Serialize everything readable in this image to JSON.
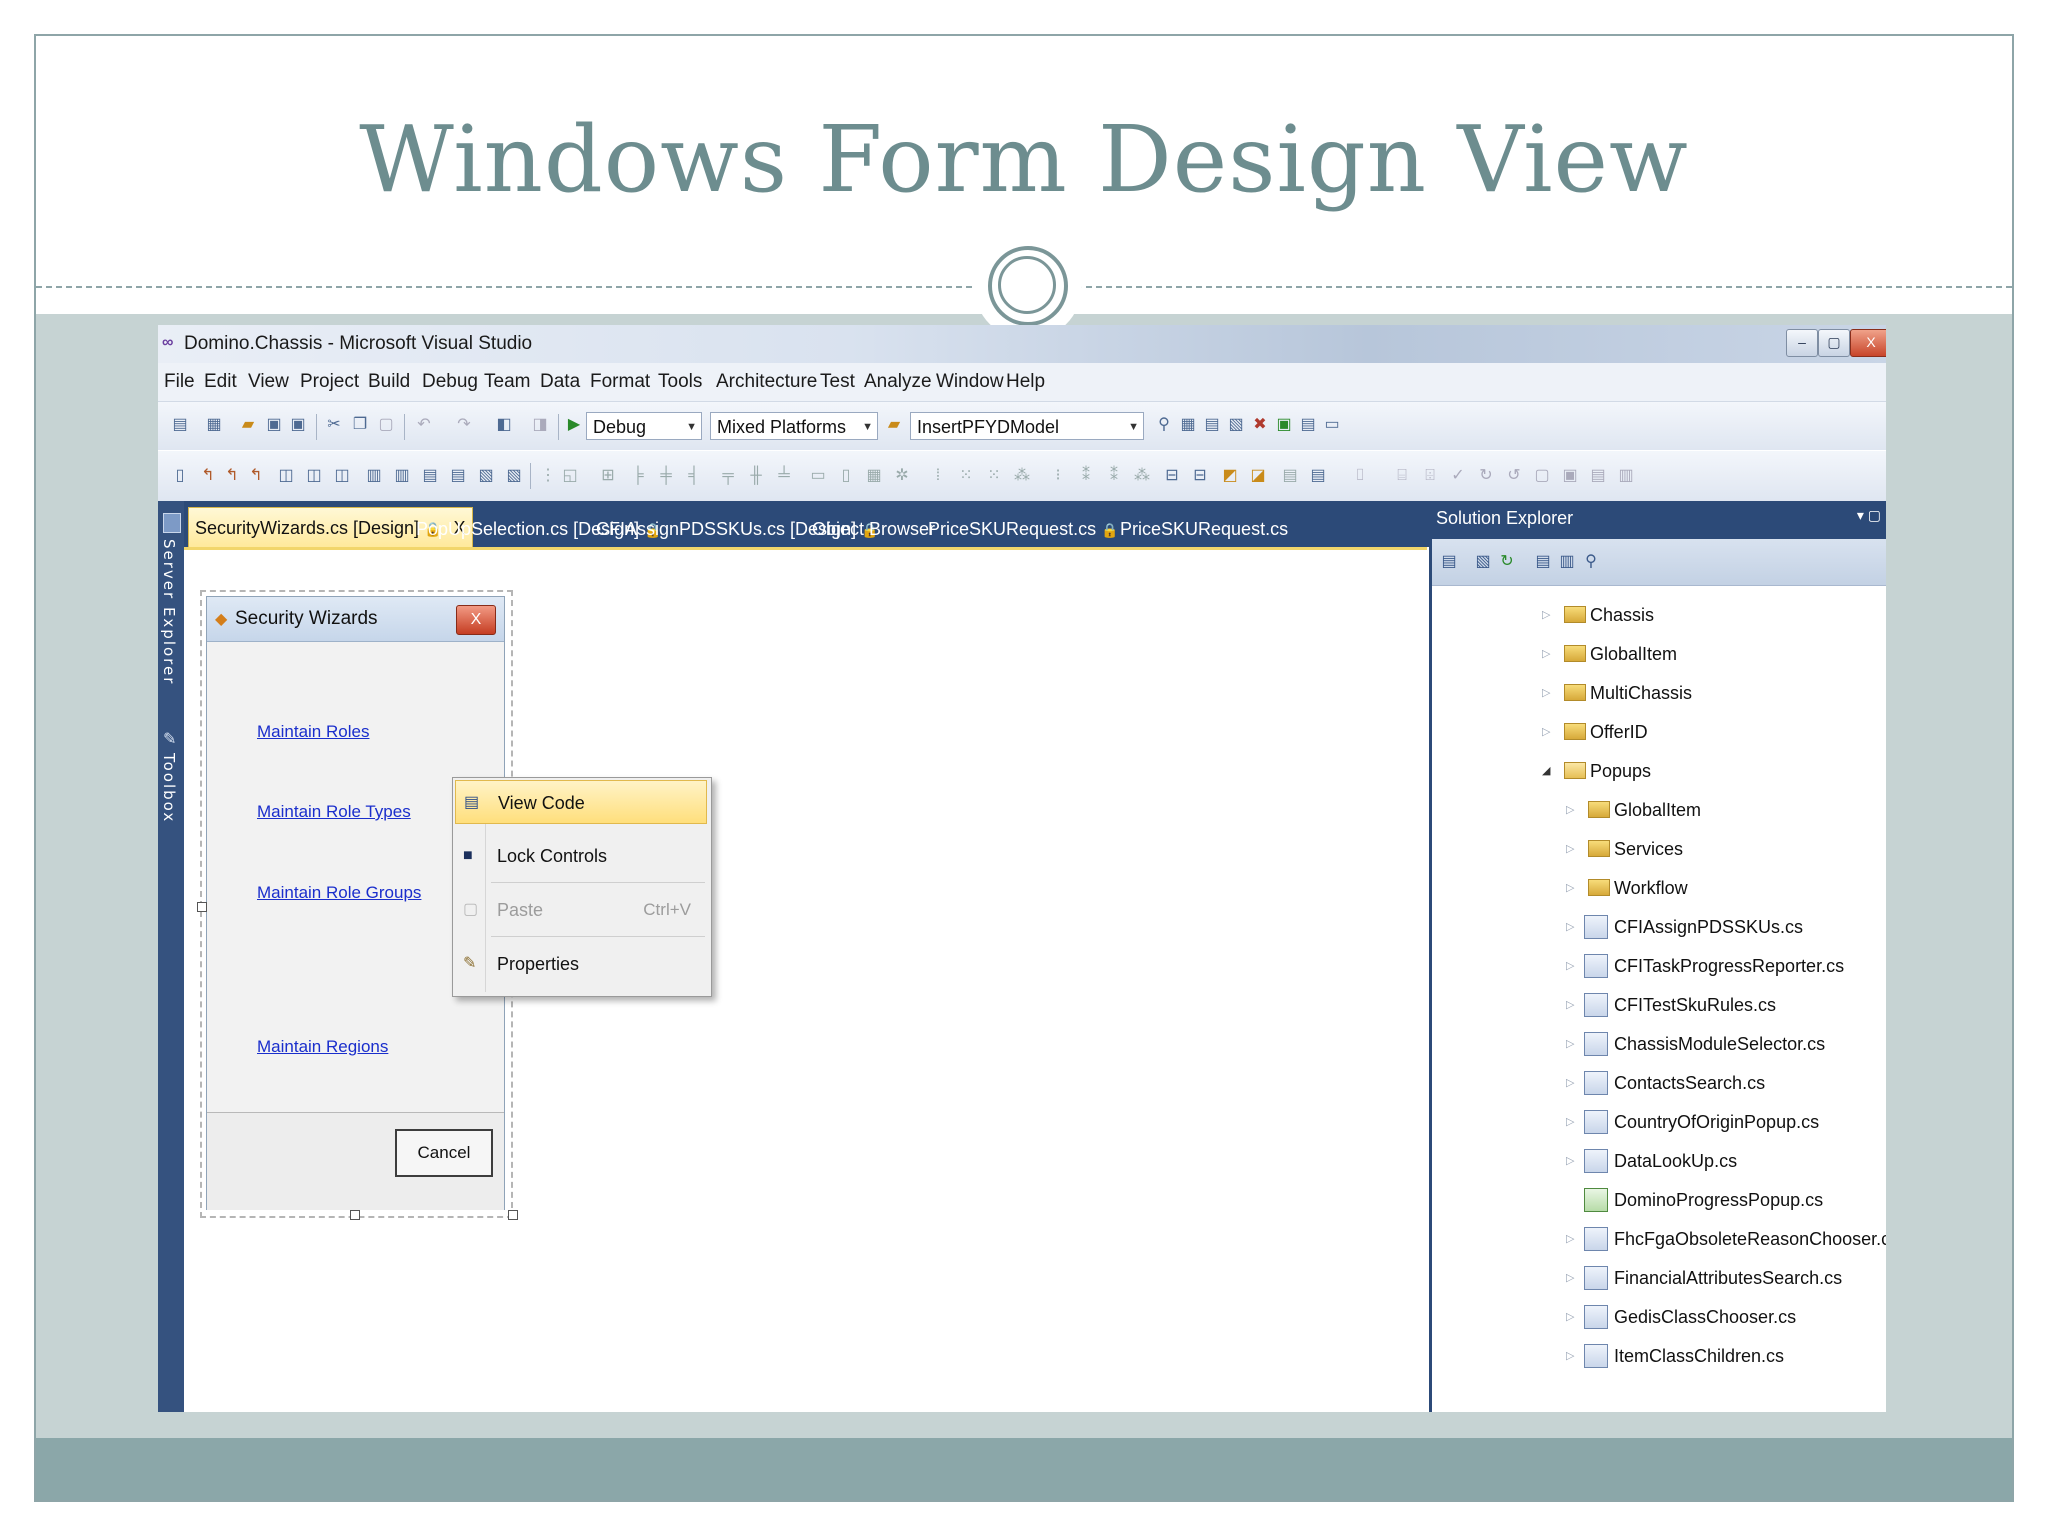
{
  "slide": {
    "title": "Windows Form Design View"
  },
  "colors": {
    "title": "#6d8d8f",
    "band": "#c6d3d3",
    "band_bottom": "#8ba7a9",
    "vs_frame_blue": "#2c4a78",
    "link": "#1a2ecc",
    "highlight": "#ffdf7c"
  },
  "vs": {
    "window_title": "Domino.Chassis - Microsoft Visual Studio",
    "window_buttons": {
      "minimize": "–",
      "maximize": "▢",
      "close": "X"
    },
    "menu": [
      "File",
      "Edit",
      "View",
      "Project",
      "Build",
      "Debug",
      "Team",
      "Data",
      "Format",
      "Tools",
      "Architecture",
      "Test",
      "Analyze",
      "Window",
      "Help"
    ],
    "toolbar": {
      "config": "Debug",
      "platform": "Mixed Platforms",
      "startup": "InsertPFYDModel"
    },
    "side_panels": {
      "server_explorer": "Server Explorer",
      "toolbox": "Toolbox"
    },
    "tabs": [
      {
        "label": "SecurityWizards.cs [Design]",
        "locked": true,
        "active": true,
        "close": "X"
      },
      {
        "label": "PopUpSelection.cs [Design]",
        "locked": true
      },
      {
        "label": "CFIAssignPDSSKUs.cs [Design]",
        "locked": true
      },
      {
        "label": "Object Browser"
      },
      {
        "label": "PriceSKURequest.cs",
        "locked": true
      },
      {
        "label": "PriceSKURequest.cs"
      }
    ],
    "lock_glyph": "🔒",
    "form": {
      "title": "Security Wizards",
      "close": "X",
      "links": [
        "Maintain Roles",
        "Maintain Role Types",
        "Maintain Role Groups",
        "Maintain Regions"
      ],
      "cancel": "Cancel"
    },
    "context_menu": {
      "view_code": "View Code",
      "lock_controls": "Lock Controls",
      "paste": "Paste",
      "paste_shortcut": "Ctrl+V",
      "properties": "Properties"
    },
    "solution_explorer": {
      "title": "Solution Explorer",
      "folders_top": [
        "Chassis",
        "GlobalItem",
        "MultiChassis",
        "OfferID",
        "Popups"
      ],
      "folders_sub": [
        "GlobalItem",
        "Services",
        "Workflow"
      ],
      "files": [
        "CFIAssignPDSSKUs.cs",
        "CFITaskProgressReporter.cs",
        "CFITestSkuRules.cs",
        "ChassisModuleSelector.cs",
        "ContactsSearch.cs",
        "CountryOfOriginPopup.cs",
        "DataLookUp.cs",
        "DominoProgressPopup.cs",
        "FhcFgaObsoleteReasonChooser.cs",
        "FinancialAttributesSearch.cs",
        "GedisClassChooser.cs",
        "ItemClassChildren.cs"
      ]
    }
  }
}
